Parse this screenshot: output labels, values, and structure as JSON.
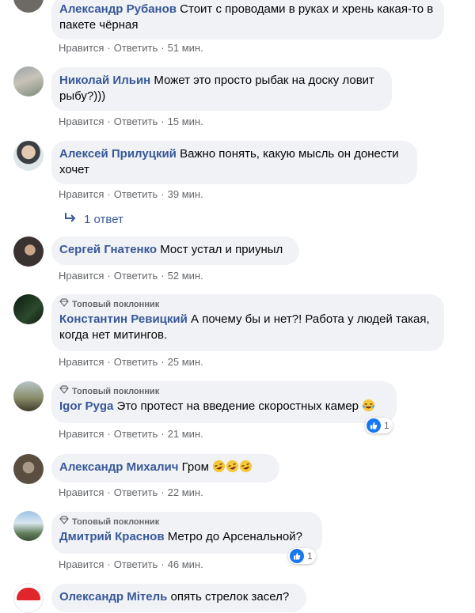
{
  "actions": {
    "like": "Нравится",
    "reply": "Ответить"
  },
  "fan_badge": "Топовый поклонник",
  "comments": [
    {
      "author": "Александр Рубанов",
      "text": "Стоит с проводами в руках и хрень какая-то в пакете чёрная",
      "time": "51 мин."
    },
    {
      "author": "Николай Ильин",
      "text": "Может это просто рыбак на доску ловит рыбу?)))",
      "time": "15 мин."
    },
    {
      "author": "Алексей Прилуцкий",
      "text": "Важно понять, какую мысль он донести хочет",
      "time": "39 мин.",
      "replies": "1 ответ"
    },
    {
      "author": "Сергей Гнатенко",
      "text": "Мост устал и приуныл",
      "time": "52 мин."
    },
    {
      "author": "Константин Ревицкий",
      "text": "А почему бы и нет?! Работа у людей такая, когда нет митингов.",
      "time": "25 мин."
    },
    {
      "author": "Igor Pyga",
      "text": "Это протест на введение скоростных камер",
      "time": "21 мин.",
      "reactions": "1"
    },
    {
      "author": "Александр Михалич",
      "text": "Гром",
      "time": "22 мин."
    },
    {
      "author": "Дмитрий Краснов",
      "text": "Метро до Арсенальной?",
      "time": "46 мин.",
      "reactions": "1"
    },
    {
      "author": "Олександр Мітель",
      "text": "опять стрелок засел?",
      "time": ""
    }
  ],
  "colors": {
    "author": "#385898",
    "bubble": "#f0f2f5",
    "meta": "#65676b",
    "like": "#1877f2"
  }
}
